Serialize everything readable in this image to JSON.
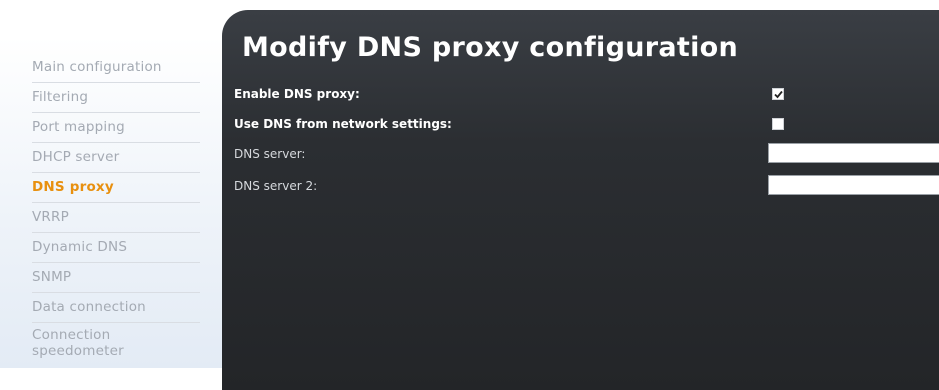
{
  "sidebar": {
    "items": [
      {
        "label": "Main configuration"
      },
      {
        "label": "Filtering"
      },
      {
        "label": "Port mapping"
      },
      {
        "label": "DHCP server"
      },
      {
        "label": "DNS proxy",
        "active": true
      },
      {
        "label": "VRRP"
      },
      {
        "label": "Dynamic DNS"
      },
      {
        "label": "SNMP"
      },
      {
        "label": "Data connection"
      },
      {
        "label": "Connection speedometer"
      }
    ]
  },
  "main": {
    "title": "Modify DNS proxy configuration",
    "fields": {
      "enable_dns_proxy": {
        "label": "Enable DNS proxy:",
        "checked": true
      },
      "use_dns_from_network": {
        "label": "Use DNS from network settings:",
        "checked": false
      },
      "dns_server": {
        "label": "DNS server:",
        "value": "",
        "placeholder": ""
      },
      "dns_server_2": {
        "label": "DNS server 2:",
        "value": "",
        "placeholder": ""
      }
    }
  },
  "colors": {
    "accent": "#e8900f",
    "panel_background": "#2b2e32",
    "sidebar_text": "#a4aab3"
  }
}
